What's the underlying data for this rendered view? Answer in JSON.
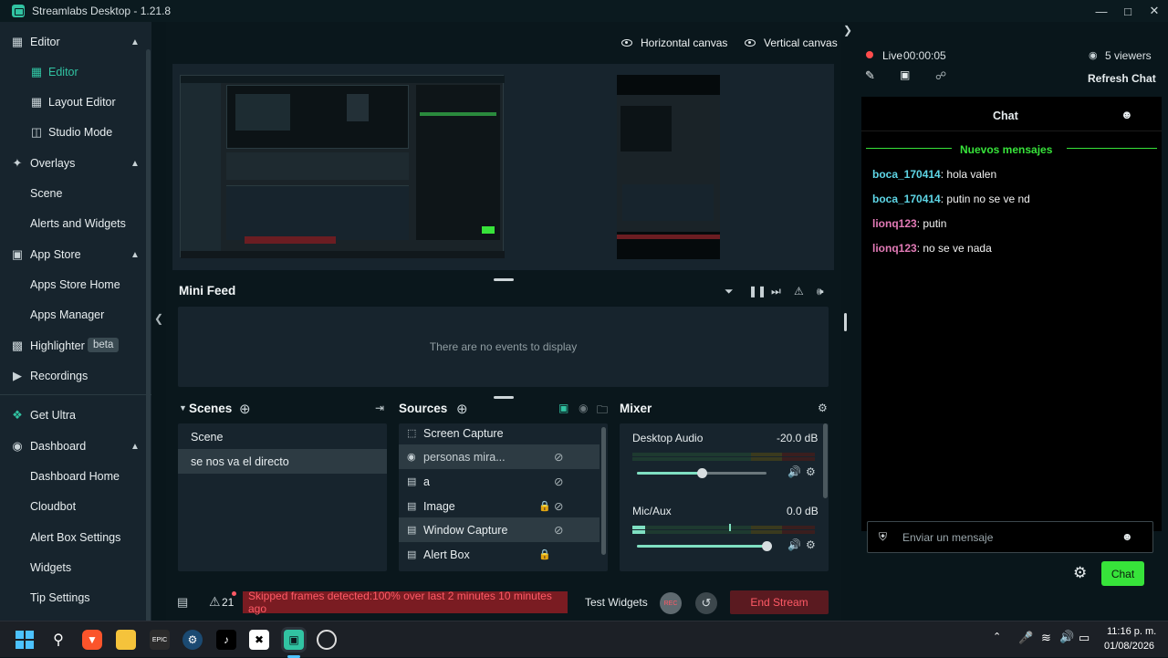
{
  "window": {
    "title": "Streamlabs Desktop - 1.21.8"
  },
  "sidebar": {
    "items": [
      {
        "label": "Editor",
        "icon": "editor-icon",
        "chevron": true
      },
      {
        "label": "Editor",
        "icon": "editor-active-icon",
        "active": true
      },
      {
        "label": "Layout Editor",
        "icon": "layout-icon"
      },
      {
        "label": "Studio Mode",
        "icon": "studio-icon"
      },
      {
        "label": "Overlays",
        "icon": "overlays-icon",
        "chevron": true
      },
      {
        "label": "Scene"
      },
      {
        "label": "Alerts and Widgets"
      },
      {
        "label": "App Store",
        "icon": "store-icon",
        "chevron": true
      },
      {
        "label": "Apps Store Home"
      },
      {
        "label": "Apps Manager"
      },
      {
        "label": "Highlighter",
        "icon": "highlighter-icon",
        "badge": "beta"
      },
      {
        "label": "Recordings",
        "icon": "recordings-icon"
      },
      {
        "label": "Get Ultra",
        "icon": "ultra-icon"
      },
      {
        "label": "Dashboard",
        "icon": "dashboard-icon",
        "chevron": true
      },
      {
        "label": "Dashboard Home"
      },
      {
        "label": "Cloudbot"
      },
      {
        "label": "Alert Box Settings"
      },
      {
        "label": "Widgets"
      },
      {
        "label": "Tip Settings"
      }
    ]
  },
  "canvas": {
    "horizontal_label": "Horizontal canvas",
    "vertical_label": "Vertical canvas"
  },
  "minifeed": {
    "title": "Mini Feed",
    "empty_text": "There are no events to display"
  },
  "scenes": {
    "title": "Scenes",
    "items": [
      "Scene",
      "se nos va el directo"
    ]
  },
  "sources": {
    "title": "Sources",
    "items": [
      {
        "label": "Screen Capture",
        "icon": "screen-capture-icon"
      },
      {
        "label": "personas mira...",
        "icon": "eye-icon"
      },
      {
        "label": "a",
        "icon": "image-icon"
      },
      {
        "label": "Image",
        "icon": "image-icon",
        "locked": true
      },
      {
        "label": "Window Capture",
        "icon": "window-icon"
      },
      {
        "label": "Alert Box",
        "icon": "alert-icon",
        "locked": true
      }
    ]
  },
  "mixer": {
    "title": "Mixer",
    "channels": [
      {
        "name": "Desktop Audio",
        "db": "-20.0 dB",
        "level": 0.5
      },
      {
        "name": "Mic/Aux",
        "db": "0.0 dB",
        "level": 1.0
      }
    ]
  },
  "bottombar": {
    "alerts_count": "21",
    "warning": "Skipped frames detected:100% over last 2 minutes 10 minutes ago",
    "test_widgets": "Test Widgets",
    "rec_label": "REC",
    "end_stream": "End Stream"
  },
  "right": {
    "live_label": "Live",
    "live_time": "00:00:05",
    "viewers": "5 viewers",
    "refresh_chat": "Refresh Chat",
    "chat_title": "Chat",
    "new_messages": "Nuevos mensajes",
    "messages": [
      {
        "user": "boca_170414",
        "text": ": hola valen",
        "color": "#5ed6e6"
      },
      {
        "user": "boca_170414",
        "text": ": putin no se ve nd",
        "color": "#5ed6e6"
      },
      {
        "user": "lionq123",
        "text": ": putin",
        "color": "#e27ab6"
      },
      {
        "user": "lionq123",
        "text": ": no se ve nada",
        "color": "#e27ab6"
      }
    ],
    "input_placeholder": "Enviar un mensaje",
    "chat_button": "Chat"
  },
  "taskbar": {
    "time": "11:16 p. m.",
    "date": "01/08/2026"
  },
  "colors": {
    "accent": "#31c3a2",
    "danger": "#ff5a66",
    "chat_green": "#37e33a"
  }
}
